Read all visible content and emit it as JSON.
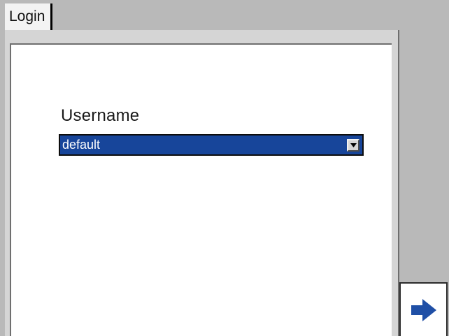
{
  "tabs": [
    {
      "label": "Login",
      "active": true
    }
  ],
  "form": {
    "username_label": "Username",
    "username_value": "default"
  },
  "icons": {
    "dropdown": "chevron-down-icon",
    "next": "arrow-right-icon"
  },
  "colors": {
    "select_background": "#17459a",
    "arrow": "#1f4fa6",
    "window_background": "#b9b9b9"
  }
}
